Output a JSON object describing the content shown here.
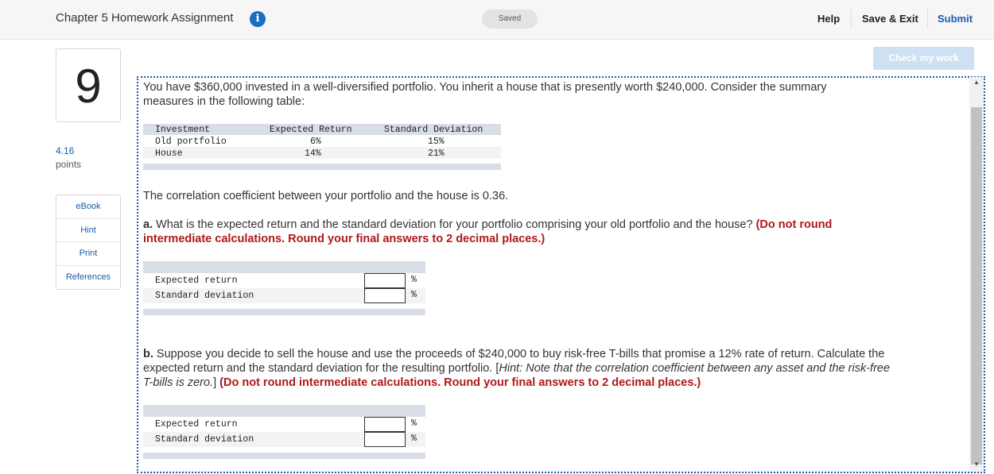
{
  "header": {
    "title": "Chapter 5 Homework Assignment",
    "info_icon": "info-icon",
    "saved_label": "Saved",
    "help_label": "Help",
    "save_exit_label": "Save & Exit",
    "submit_label": "Submit",
    "brand_color": "#1a5dac"
  },
  "question": {
    "number": "9",
    "points_value": "4.16",
    "points_label": "points"
  },
  "sidebar": {
    "items": [
      {
        "label": "eBook"
      },
      {
        "label": "Hint"
      },
      {
        "label": "Print"
      },
      {
        "label": "References"
      }
    ]
  },
  "check_work_label": "Check my work",
  "body": {
    "intro": "You have $360,000 invested in a well-diversified portfolio. You inherit a house that is presently worth $240,000. Consider the summary measures in the following table:",
    "summary_table": {
      "headers": [
        "Investment",
        "Expected Return",
        "Standard Deviation"
      ],
      "rows": [
        [
          "Old portfolio",
          "6%",
          "15%"
        ],
        [
          "House",
          "14%",
          "21%"
        ]
      ]
    },
    "correlation_text": "The correlation coefficient between your portfolio and the house is 0.36.",
    "part_a": {
      "label": "a.",
      "text": " What is the expected return and the standard deviation for your portfolio comprising your old portfolio and the house? ",
      "instruction": "(Do not round intermediate calculations. Round your final answers to 2 decimal places.)",
      "rows": [
        {
          "label": "Expected return",
          "value": "",
          "unit": "%"
        },
        {
          "label": "Standard deviation",
          "value": "",
          "unit": "%"
        }
      ]
    },
    "part_b": {
      "label": "b.",
      "text": " Suppose you decide to sell the house and use the proceeds of $240,000 to buy risk-free T-bills that promise a 12% rate of return. Calculate the expected return and the standard deviation for the resulting portfolio. [",
      "hint_label": "Hint:",
      "hint_text": " Note that the correlation coefficient between any asset and the risk-free T-bills is zero.",
      "hint_close": "] ",
      "instruction": "(Do not round intermediate calculations. Round your final answers to 2 decimal places.)",
      "rows": [
        {
          "label": "Expected return",
          "value": "",
          "unit": "%"
        },
        {
          "label": "Standard deviation",
          "value": "",
          "unit": "%"
        }
      ]
    }
  }
}
